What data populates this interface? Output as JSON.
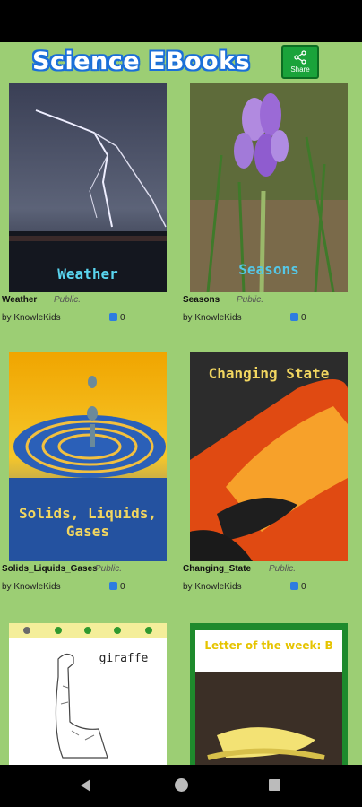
{
  "app": {
    "title": "Science EBooks",
    "share_label": "Share"
  },
  "books": [
    {
      "title": "Weather",
      "cover_text": "Weather",
      "visibility": "Public.",
      "author": "by KnowleKids",
      "likes": "0"
    },
    {
      "title": "Seasons",
      "cover_text": "Seasons",
      "visibility": "Public.",
      "author": "by KnowleKids",
      "likes": "0"
    },
    {
      "title": "Solids_Liquids_Gases",
      "cover_text_line1": "Solids, Liquids,",
      "cover_text_line2": "Gases",
      "visibility": "Public.",
      "author": "by KnowleKids",
      "likes": "0"
    },
    {
      "title": "Changing_State",
      "cover_text": "Changing State",
      "visibility": "Public.",
      "author": "by KnowleKids",
      "likes": "0"
    },
    {
      "cover_text": "giraffe"
    },
    {
      "cover_text": "Letter of the week: B"
    }
  ],
  "colors": {
    "background": "#9cce74",
    "title_outline": "#1b6fd8",
    "share_green": "#1aa33a",
    "like_blue": "#2d7de0"
  }
}
